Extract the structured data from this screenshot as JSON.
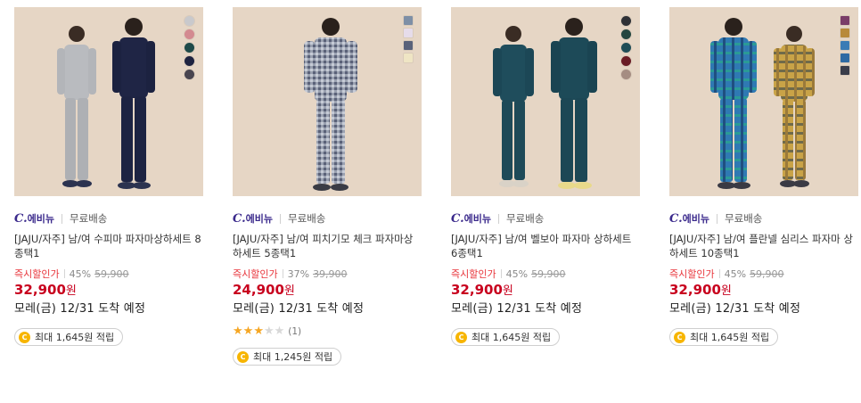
{
  "products": [
    {
      "seller": {
        "logo": "C.",
        "logo_ko": "에비뉴",
        "shipping": "무료배송"
      },
      "title": "[JAJU/자주] 남/여 수피마 파자마상하세트 8종택1",
      "discount": {
        "label": "즉시할인가",
        "rate": "45%",
        "original": "59,900"
      },
      "price": "32,900",
      "price_unit": "원",
      "arrival": "모레(금) 12/31 도착 예정",
      "points": "최대 1,645원 적립",
      "coin": "C",
      "colors": [
        "#c9c9cc",
        "#d38a90",
        "#1e4a49",
        "#1e2340",
        "#49454f"
      ]
    },
    {
      "seller": {
        "logo": "C.",
        "logo_ko": "에비뉴",
        "shipping": "무료배송"
      },
      "title": "[JAJU/자주] 남/여 피치기모 체크 파자마상하세트 5종택1",
      "discount": {
        "label": "즉시할인가",
        "rate": "37%",
        "original": "39,900"
      },
      "price": "24,900",
      "price_unit": "원",
      "arrival": "모레(금) 12/31 도착 예정",
      "rating": {
        "stars": 3,
        "max": 5,
        "count": "(1)"
      },
      "points": "최대 1,245원 적립",
      "coin": "C",
      "colors": [
        "#7e8fa6",
        "#e6dcea",
        "#59627a",
        "#efe5c4"
      ]
    },
    {
      "seller": {
        "logo": "C.",
        "logo_ko": "에비뉴",
        "shipping": "무료배송"
      },
      "title": "[JAJU/자주] 남/여 벨보아 파자마 상하세트 6종택1",
      "discount": {
        "label": "즉시할인가",
        "rate": "45%",
        "original": "59,900"
      },
      "price": "32,900",
      "price_unit": "원",
      "arrival": "모레(금) 12/31 도착 예정",
      "points": "최대 1,645원 적립",
      "coin": "C",
      "colors": [
        "#2f3136",
        "#24463f",
        "#1f4d57",
        "#6a1c25",
        "#a58d82"
      ]
    },
    {
      "seller": {
        "logo": "C.",
        "logo_ko": "에비뉴",
        "shipping": "무료배송"
      },
      "title": "[JAJU/자주] 남/여 플란넬 심리스 파자마 상하세트 10종택1",
      "discount": {
        "label": "즉시할인가",
        "rate": "45%",
        "original": "59,900"
      },
      "price": "32,900",
      "price_unit": "원",
      "arrival": "모레(금) 12/31 도착 예정",
      "points": "최대 1,645원 적립",
      "coin": "C",
      "colors": [
        "#7a3d68",
        "#b88a3a",
        "#3a7bb5",
        "#2e6aa3",
        "#3a3d4a"
      ]
    }
  ],
  "colors": {
    "accent_price": "#c8001e",
    "discount_label": "#e8343a",
    "star": "#f5a623",
    "logo": "#3b2a8c",
    "coin": "#f7b500"
  }
}
